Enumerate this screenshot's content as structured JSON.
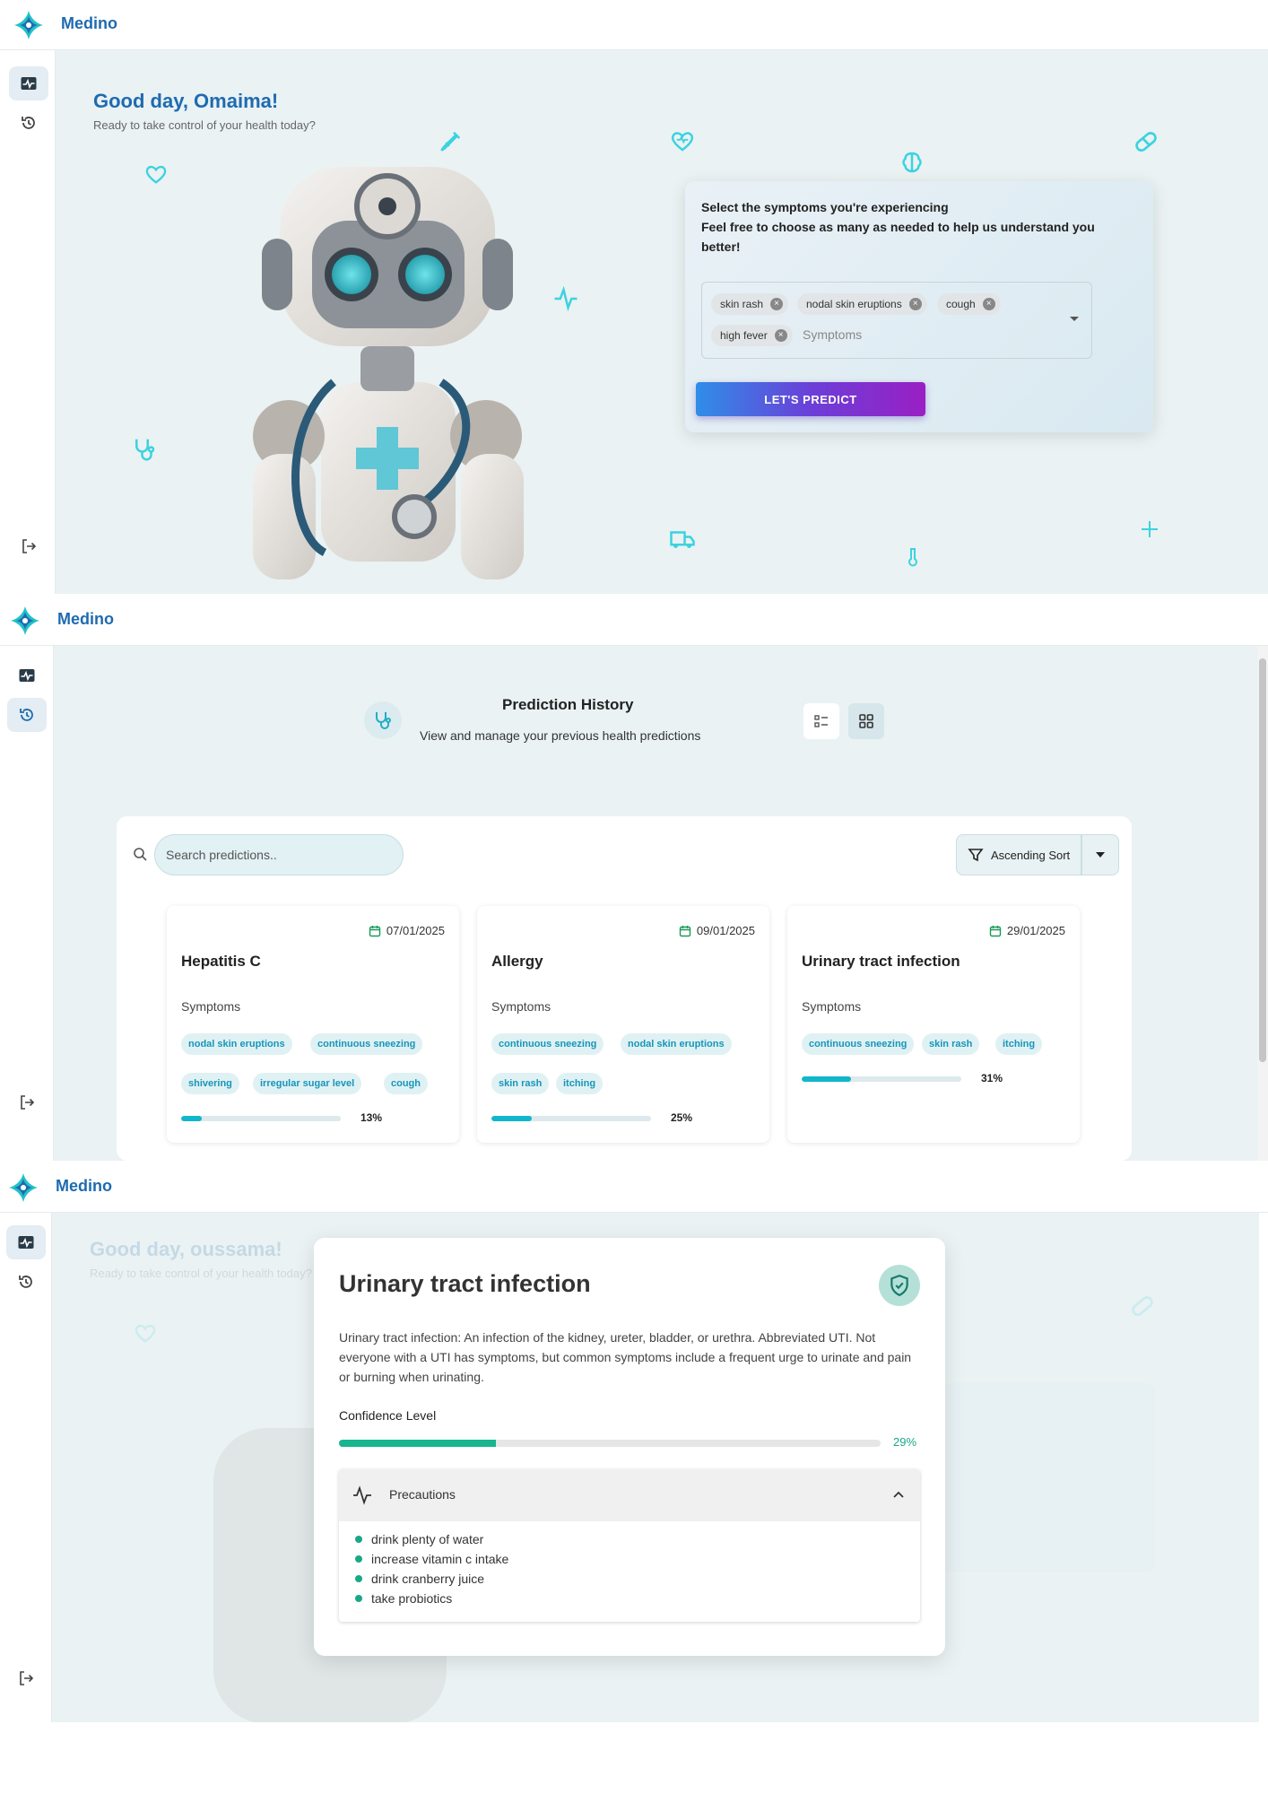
{
  "brand": "Medino",
  "colors": {
    "brand": "#1e6bb0",
    "accent": "#11b6cc",
    "confidence": "#18b58e"
  },
  "screen1": {
    "greeting": "Good day, Omaima!",
    "greeting_sub": "Ready to take control of your health today?",
    "symptom_prompt_line1": "Select the symptoms you're experiencing",
    "symptom_prompt_line2": "Feel free to choose as many as needed to help us understand you better!",
    "selected_symptoms": [
      "skin rash",
      "nodal skin eruptions",
      "cough",
      "high fever"
    ],
    "symptoms_placeholder": "Symptoms",
    "predict_button": "LET'S PREDICT"
  },
  "screen2": {
    "title": "Prediction History",
    "subtitle": "View and manage your previous health predictions",
    "search_placeholder": "Search predictions..",
    "sort_label": "Ascending Sort",
    "symptoms_label": "Symptoms",
    "predictions": [
      {
        "date": "07/01/2025",
        "disease": "Hepatitis C",
        "symptoms": [
          "nodal skin eruptions",
          "continuous sneezing",
          "shivering",
          "irregular sugar level",
          "cough"
        ],
        "confidence": 13,
        "confidence_label": "13%"
      },
      {
        "date": "09/01/2025",
        "disease": "Allergy",
        "symptoms": [
          "continuous sneezing",
          "nodal skin eruptions",
          "skin rash",
          "itching"
        ],
        "confidence": 25,
        "confidence_label": "25%"
      },
      {
        "date": "29/01/2025",
        "disease": "Urinary tract infection",
        "symptoms": [
          "continuous sneezing",
          "skin rash",
          "itching"
        ],
        "confidence": 31,
        "confidence_label": "31%"
      }
    ]
  },
  "screen3": {
    "background_greeting": "Good day, oussama!",
    "background_sub": "Ready to take control of your health today?",
    "disease": "Urinary tract infection",
    "description": "Urinary tract infection: An infection of the kidney, ureter, bladder, or urethra. Abbreviated UTI. Not everyone with a UTI has symptoms, but common symptoms include a frequent urge to urinate and pain or burning when urinating.",
    "confidence_label": "Confidence Level",
    "confidence": 29,
    "confidence_text": "29%",
    "precautions_label": "Precautions",
    "precautions": [
      "drink plenty of water",
      "increase vitamin c intake",
      "drink cranberry juice",
      "take probiotics"
    ]
  },
  "icons": {
    "logo": "medical-cross-logo",
    "sidebar_predict": "heart-monitor-icon",
    "sidebar_history": "history-icon",
    "sidebar_logout": "logout-icon"
  }
}
